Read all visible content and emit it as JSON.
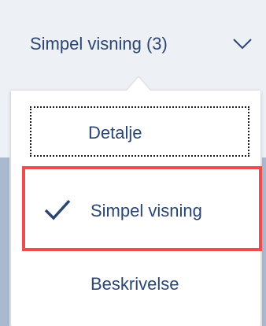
{
  "view_toggle": {
    "label": "Simpel visning (3)",
    "icon": "chevron-down-icon"
  },
  "menu": {
    "items": [
      {
        "label": "Detalje",
        "selected": false,
        "focused": true
      },
      {
        "label": "Simpel visning",
        "selected": true,
        "focused": false,
        "icon": "check-icon"
      },
      {
        "label": "Beskrivelse",
        "selected": false,
        "focused": false
      }
    ]
  },
  "colors": {
    "text": "#2b4672",
    "highlight_border": "#ed4c50",
    "background": "#edf0f5",
    "side_strip": "#a9b9cf",
    "menu_background": "#ffffff"
  }
}
